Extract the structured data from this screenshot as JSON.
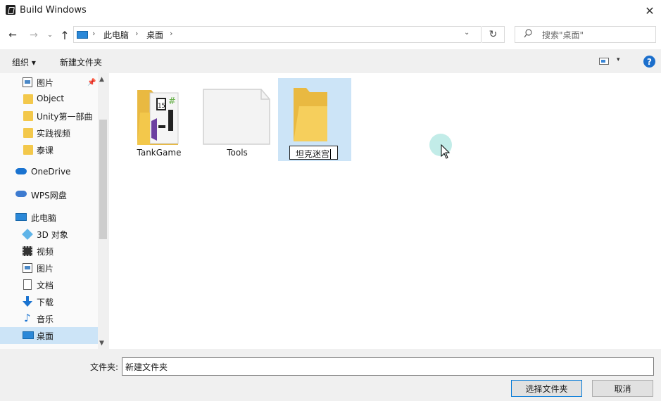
{
  "window": {
    "title": "Build Windows",
    "close_glyph": "✕"
  },
  "nav": {
    "back": "←",
    "forward": "→",
    "recent": "⌄",
    "up": "↑",
    "breadcrumbs": [
      "此电脑",
      "桌面"
    ],
    "separator": "›",
    "dropdown": "⌄",
    "refresh": "↻",
    "search_placeholder": "搜索\"桌面\""
  },
  "toolbar": {
    "organize": "组织 ▾",
    "new_folder": "新建文件夹",
    "view_dropdown": "▾",
    "help": "?"
  },
  "sidebar": {
    "items": [
      {
        "label": "图片",
        "icon": "picture-icon"
      },
      {
        "label": "Object",
        "icon": "folder-icon"
      },
      {
        "label": "Unity第一部曲",
        "icon": "folder-icon"
      },
      {
        "label": "实践视频",
        "icon": "folder-icon"
      },
      {
        "label": "泰课",
        "icon": "folder-icon"
      },
      {
        "label": "OneDrive",
        "icon": "cloud-icon"
      },
      {
        "label": "WPS网盘",
        "icon": "wps-cloud-icon"
      },
      {
        "label": "此电脑",
        "icon": "computer-icon"
      },
      {
        "label": "3D 对象",
        "icon": "3d-objects-icon"
      },
      {
        "label": "视频",
        "icon": "video-icon"
      },
      {
        "label": "图片",
        "icon": "picture-icon"
      },
      {
        "label": "文档",
        "icon": "document-icon"
      },
      {
        "label": "下载",
        "icon": "download-icon"
      },
      {
        "label": "音乐",
        "icon": "music-icon"
      },
      {
        "label": "桌面",
        "icon": "desktop-icon"
      }
    ],
    "selected_index": 14
  },
  "files": [
    {
      "name": "TankGame",
      "type": "folder-with-content"
    },
    {
      "name": "Tools",
      "type": "empty-folder"
    },
    {
      "name": "坦克迷宫",
      "type": "folder",
      "state": "renaming"
    }
  ],
  "footer": {
    "folder_label": "文件夹:",
    "folder_value": "新建文件夹",
    "select_button": "选择文件夹",
    "cancel_button": "取消"
  },
  "colors": {
    "accent": "#0078d7",
    "selection": "#cce4f7",
    "folder": "#f3c84b"
  }
}
